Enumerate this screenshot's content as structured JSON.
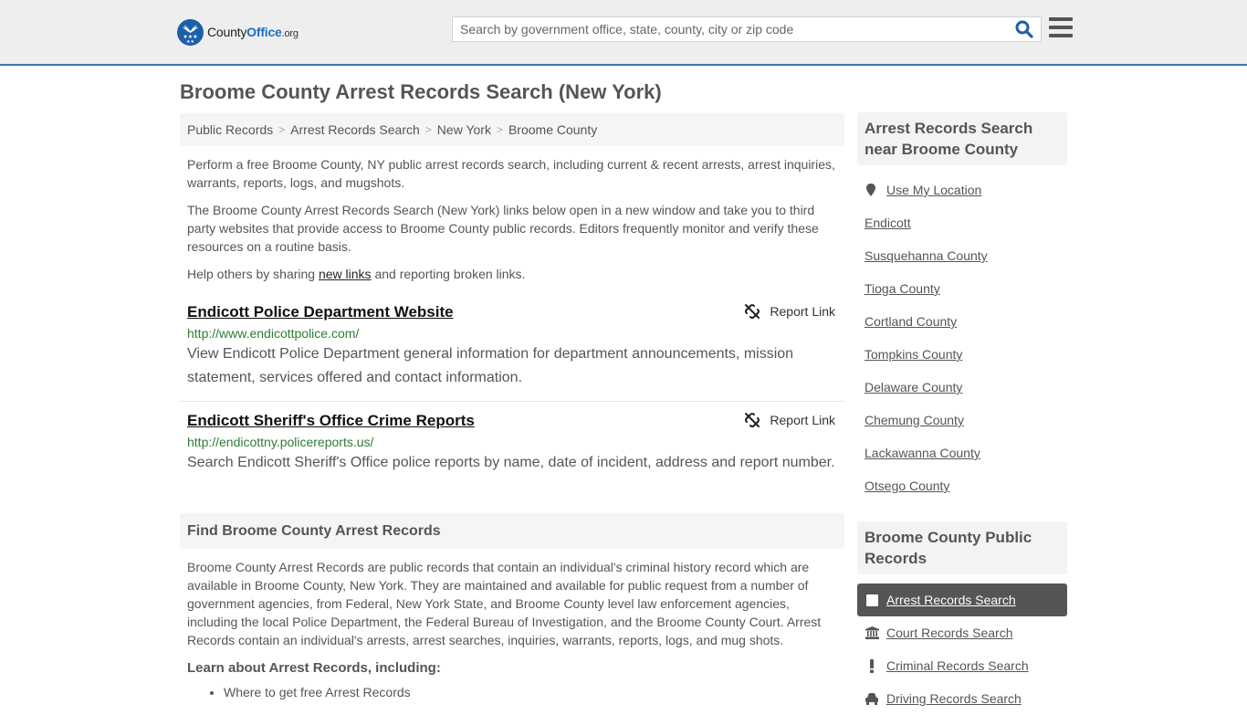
{
  "header": {
    "logo": {
      "county": "County",
      "office": "Office",
      "org": ".org"
    },
    "search_placeholder": "Search by government office, state, county, city or zip code",
    "search_value": ""
  },
  "page_title": "Broome County Arrest Records Search (New York)",
  "breadcrumb": [
    "Public Records",
    "Arrest Records Search",
    "New York",
    "Broome County"
  ],
  "intro": {
    "p1": "Perform a free Broome County, NY public arrest records search, including current & recent arrests, arrest inquiries, warrants, reports, logs, and mugshots.",
    "p2": "The Broome County Arrest Records Search (New York) links below open in a new window and take you to third party websites that provide access to Broome County public records. Editors frequently monitor and verify these resources on a routine basis.",
    "p3_before": "Help others by sharing ",
    "p3_link": "new links",
    "p3_after": " and reporting broken links."
  },
  "entries": [
    {
      "title": "Endicott Police Department Website",
      "url": "http://www.endicottpolice.com/",
      "description": "View Endicott Police Department general information for department announcements, mission statement, services offered and contact information.",
      "report_label": "Report Link"
    },
    {
      "title": "Endicott Sheriff's Office Crime Reports",
      "url": "http://endicottny.policereports.us/",
      "description": "Search Endicott Sheriff's Office police reports by name, date of incident, address and report number.",
      "report_label": "Report Link"
    }
  ],
  "find_section": {
    "heading": "Find Broome County Arrest Records",
    "body": "Broome County Arrest Records are public records that contain an individual's criminal history record which are available in Broome County, New York. They are maintained and available for public request from a number of government agencies, from Federal, New York State, and Broome County level law enforcement agencies, including the local Police Department, the Federal Bureau of Investigation, and the Broome County Court. Arrest Records contain an individual's arrests, arrest searches, inquiries, warrants, reports, logs, and mug shots.",
    "learn_heading": "Learn about Arrest Records, including:",
    "learn_items": [
      "Where to get free Arrest Records"
    ]
  },
  "sidebar": {
    "nearby_heading": "Arrest Records Search near Broome County",
    "use_location": "Use My Location",
    "nearby": [
      "Endicott",
      "Susquehanna County",
      "Tioga County",
      "Cortland County",
      "Tompkins County",
      "Delaware County",
      "Chemung County",
      "Lackawanna County",
      "Otsego County"
    ],
    "public_heading": "Broome County Public Records",
    "records": [
      {
        "label": "Arrest Records Search",
        "icon": "square-icon",
        "active": true
      },
      {
        "label": "Court Records Search",
        "icon": "courthouse-icon",
        "active": false
      },
      {
        "label": "Criminal Records Search",
        "icon": "exclamation-icon",
        "active": false
      },
      {
        "label": "Driving Records Search",
        "icon": "car-icon",
        "active": false
      }
    ]
  },
  "colors": {
    "accent": "#337ab7",
    "url_green": "#2e7d32",
    "active_bg": "#555555",
    "logo_blue": "#1d5fa8"
  }
}
